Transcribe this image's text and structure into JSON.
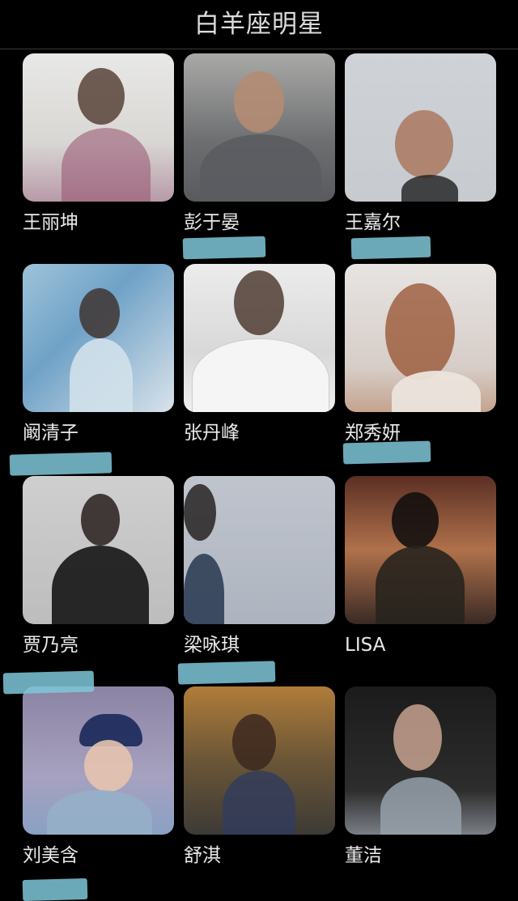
{
  "header": {
    "title": "白羊座明星"
  },
  "celebrities": [
    {
      "name": "王丽坤"
    },
    {
      "name": "彭于晏"
    },
    {
      "name": "王嘉尔"
    },
    {
      "name": "阚清子"
    },
    {
      "name": "张丹峰"
    },
    {
      "name": "郑秀妍"
    },
    {
      "name": "贾乃亮"
    },
    {
      "name": "梁咏琪"
    },
    {
      "name": "LISA"
    },
    {
      "name": "刘美含"
    },
    {
      "name": "舒淇"
    },
    {
      "name": "董洁"
    }
  ],
  "colors": {
    "background": "#000000",
    "text": "#eaeaea",
    "highlight_mark": "#7fc7d8"
  }
}
